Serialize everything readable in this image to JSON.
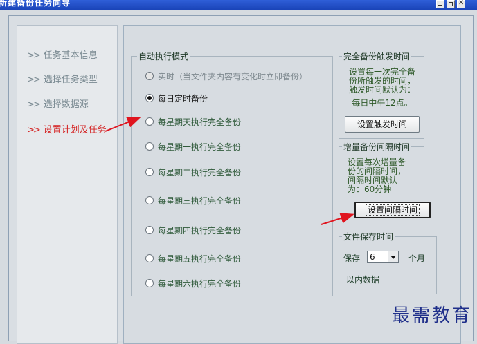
{
  "window": {
    "title": "新建备份任务向导"
  },
  "sidebar": {
    "items": [
      {
        "label": "任务基本信息",
        "active": false
      },
      {
        "label": "选择任务类型",
        "active": false
      },
      {
        "label": "选择数据源",
        "active": false
      },
      {
        "label": "设置计划及任务",
        "active": true
      }
    ],
    "chevron": ">>"
  },
  "auto_mode": {
    "legend": "自动执行模式",
    "options": [
      {
        "label": "实时（当文件夹内容有变化时立即备份）",
        "state": "disabled"
      },
      {
        "label": "每日定时备份",
        "state": "checked"
      },
      {
        "label": "每星期天执行完全备份",
        "state": "normal"
      },
      {
        "label": "每星期一执行完全备份",
        "state": "normal"
      },
      {
        "label": "每星期二执行完全备份",
        "state": "normal"
      },
      {
        "label": "每星期三执行完全备份",
        "state": "normal"
      },
      {
        "label": "每星期四执行完全备份",
        "state": "normal"
      },
      {
        "label": "每星期五执行完全备份",
        "state": "normal"
      },
      {
        "label": "每星期六执行完全备份",
        "state": "normal"
      }
    ]
  },
  "full_backup": {
    "legend": "完全备份触发时间",
    "desc_lines": [
      "设置每一次完全备",
      "份所触发的时间，",
      "触发时间默认为：",
      "每日中午12点。"
    ],
    "button": "设置触发时间"
  },
  "incremental": {
    "legend": "增量备份间隔时间",
    "desc_lines": [
      "设置每次增量备",
      "份的间隔时间，",
      "间隔时间默认",
      "为：60分钟"
    ],
    "button": "设置间隔时间"
  },
  "retention": {
    "legend": "文件保存时间",
    "prefix": "保存",
    "value": "6",
    "unit": "个月",
    "suffix": "以内数据"
  },
  "watermark": "最需教育",
  "colors": {
    "arrow": "#e0141e",
    "active_nav": "#d42020"
  }
}
